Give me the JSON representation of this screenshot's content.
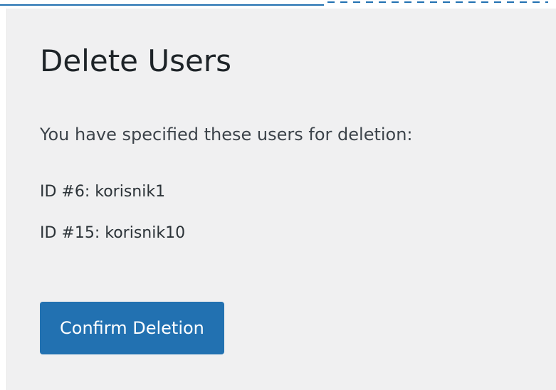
{
  "page": {
    "title": "Delete Users",
    "intro": "You have specified these users for deletion:"
  },
  "users": [
    {
      "label": "ID #6: korisnik1"
    },
    {
      "label": "ID #15: korisnik10"
    }
  ],
  "actions": {
    "confirm_label": "Confirm Deletion"
  },
  "colors": {
    "accent": "#2271b1",
    "panel_bg": "#f0f0f1",
    "text": "#1d2327"
  }
}
